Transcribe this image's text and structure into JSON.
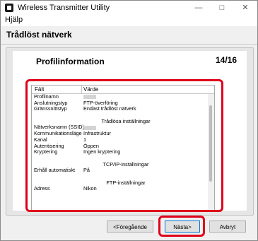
{
  "window": {
    "title": "Wireless Transmitter Utility",
    "controls": {
      "minimize": "—",
      "maximize": "□",
      "close": "✕"
    }
  },
  "menu": {
    "help": "Hjälp"
  },
  "header": {
    "title": "Trådlöst nätverk"
  },
  "section": {
    "title": "Profilinformation",
    "page_counter": "14/16"
  },
  "table": {
    "headers": {
      "field": "Fält",
      "value": "Värde"
    },
    "rows": [
      {
        "type": "item",
        "field": "Profilnamn",
        "value": "",
        "redacted": true
      },
      {
        "type": "item",
        "field": "Anslutningstyp",
        "value": "FTP-överföring"
      },
      {
        "type": "item",
        "field": "Gränssnittstyp",
        "value": "Endast trådlöst nätverk"
      },
      {
        "type": "blank"
      },
      {
        "type": "group",
        "label": "Trådlösa inställningar"
      },
      {
        "type": "item",
        "field": "Nätverksnamn (SSID)",
        "value": "",
        "redacted": true
      },
      {
        "type": "item",
        "field": "Kommunikationsläge",
        "value": "Infrastruktur"
      },
      {
        "type": "item",
        "field": "Kanal",
        "value": "1"
      },
      {
        "type": "item",
        "field": "Autentisering",
        "value": "Öppen"
      },
      {
        "type": "item",
        "field": "Kryptering",
        "value": "Ingen kryptering"
      },
      {
        "type": "blank"
      },
      {
        "type": "group",
        "label": "TCP/IP-inställningar"
      },
      {
        "type": "item",
        "field": "Erhåll automatiskt",
        "value": "På"
      },
      {
        "type": "blank"
      },
      {
        "type": "group",
        "label": "FTP-inställningar"
      },
      {
        "type": "item",
        "field": "Adress",
        "value": "Nikon"
      }
    ]
  },
  "buttons": {
    "previous": "<Föregående",
    "next": "Nästa>",
    "cancel": "Avbryt"
  },
  "colors": {
    "highlight": "#e0001b",
    "focus": "#0078d7"
  }
}
